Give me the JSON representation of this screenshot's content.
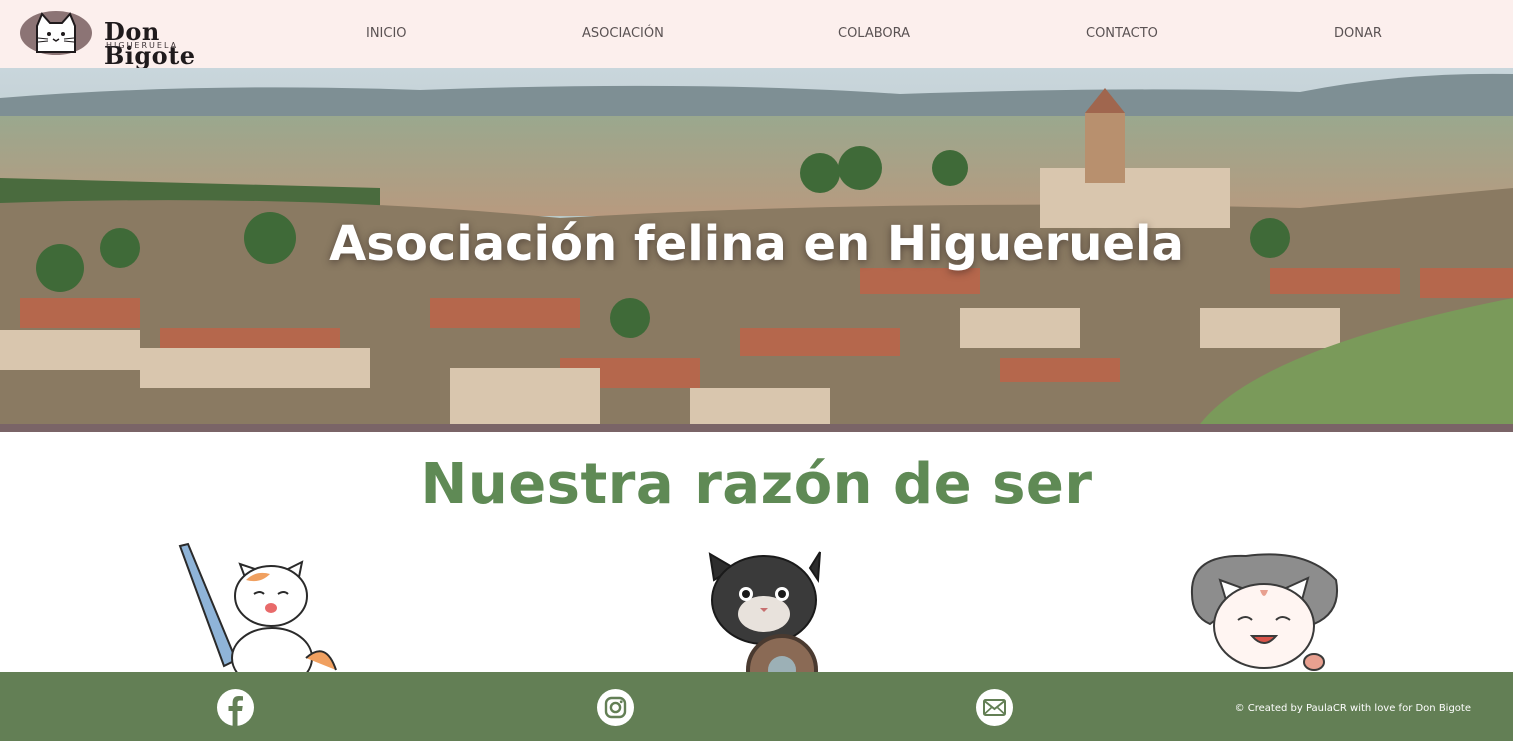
{
  "brand": {
    "title": "Don Bigote",
    "subtitle": "HIGUERUELA"
  },
  "nav": [
    {
      "label": "INICIO"
    },
    {
      "label": "ASOCIACIÓN"
    },
    {
      "label": "COLABORA"
    },
    {
      "label": "CONTACTO"
    },
    {
      "label": "DONAR"
    }
  ],
  "hero": {
    "title": "Asociación felina en Higueruela"
  },
  "section": {
    "title": "Nuestra razón de ser"
  },
  "cats": [
    {
      "icon": "cat-knight-lance-icon"
    },
    {
      "icon": "cat-shield-icon"
    },
    {
      "icon": "cat-hat-icon"
    }
  ],
  "footer": {
    "social": [
      {
        "icon": "facebook-icon"
      },
      {
        "icon": "instagram-icon"
      },
      {
        "icon": "email-icon"
      }
    ],
    "credit": "© Created by PaulaCR with love for Don Bigote"
  },
  "colors": {
    "header_bg": "#fcefed",
    "accent_green": "#5f8a55",
    "footer_bg": "#637f55",
    "hero_bar": "#7a6467"
  }
}
